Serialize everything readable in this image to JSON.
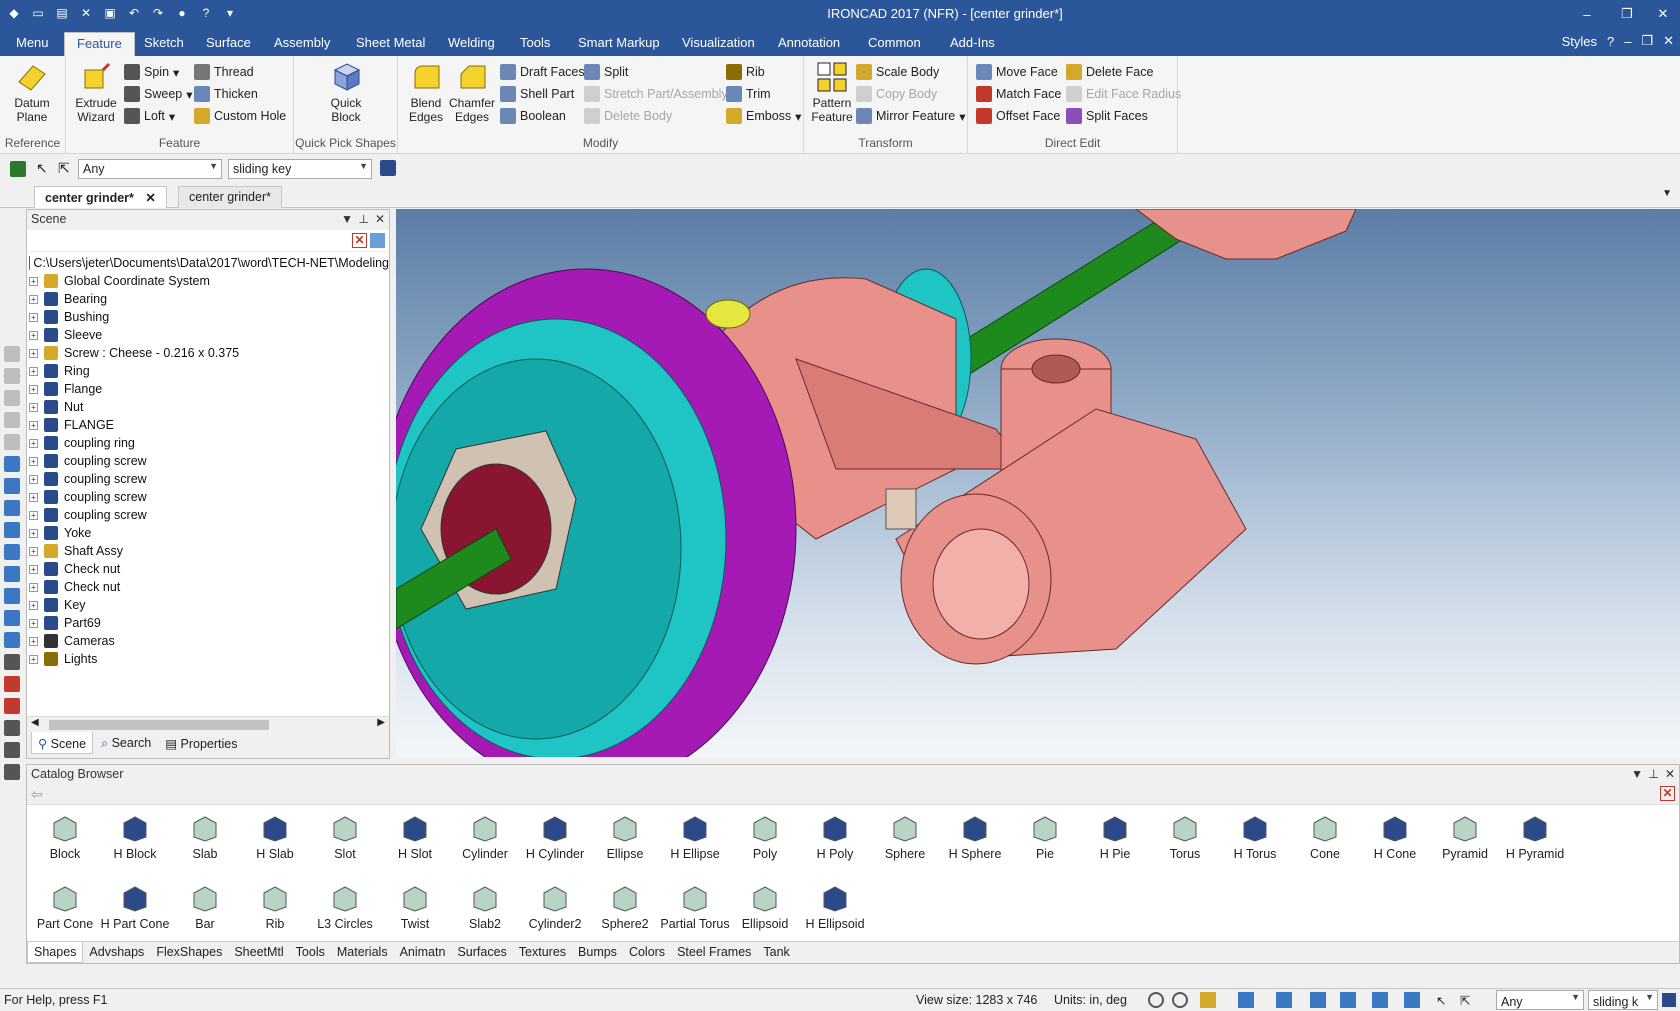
{
  "titlebar": {
    "title": "IRONCAD 2017 (NFR) - [center grinder*]",
    "minimize": "–",
    "restore": "❐",
    "close": "✕"
  },
  "menu_tabs": [
    "Menu",
    "Feature",
    "Sketch",
    "Surface",
    "Assembly",
    "Sheet Metal",
    "Welding",
    "Tools",
    "Smart Markup",
    "Visualization",
    "Annotation",
    "Common",
    "Add-Ins"
  ],
  "menu_right": {
    "styles": "Styles",
    "help": "?"
  },
  "ribbon": {
    "reference": {
      "label": "Reference",
      "datum_plane": "Datum Plane"
    },
    "feature": {
      "label": "Feature",
      "extrude_wizard": "Extrude Wizard",
      "spin": "Spin",
      "sweep": "Sweep",
      "loft": "Loft",
      "thread": "Thread",
      "thicken": "Thicken",
      "custom_hole": "Custom Hole"
    },
    "quick_pick": {
      "label": "Quick Pick Shapes",
      "quick_block": "Quick Block"
    },
    "modify": {
      "label": "Modify",
      "blend_edges": "Blend Edges",
      "chamfer_edges": "Chamfer Edges",
      "draft_faces": "Draft Faces",
      "shell_part": "Shell Part",
      "boolean": "Boolean",
      "split": "Split",
      "stretch": "Stretch Part/Assembly",
      "delete_body": "Delete Body",
      "rib": "Rib",
      "trim": "Trim",
      "emboss": "Emboss"
    },
    "transform": {
      "label": "Transform",
      "pattern_feature": "Pattern Feature",
      "scale_body": "Scale Body",
      "copy_body": "Copy Body",
      "mirror_feature": "Mirror Feature"
    },
    "direct_edit": {
      "label": "Direct Edit",
      "move_face": "Move Face",
      "match_face": "Match Face",
      "offset_face": "Offset Face",
      "delete_face": "Delete Face",
      "edit_face_radius": "Edit Face Radius",
      "split_faces": "Split Faces"
    }
  },
  "filter": {
    "type": "Any",
    "name": "sliding key"
  },
  "doc_tabs": [
    "center grinder*",
    "center grinder*"
  ],
  "scene": {
    "title": "Scene",
    "path": "C:\\Users\\jeter\\Documents\\Data\\2017\\word\\TECH-NET\\Modeling",
    "items": [
      "Global Coordinate System",
      "Bearing",
      "Bushing",
      "Sleeve",
      "Screw : Cheese - 0.216 x 0.375",
      "Ring",
      "Flange",
      "Nut",
      "FLANGE",
      "coupling ring",
      "coupling screw",
      "coupling screw",
      "coupling screw",
      "coupling screw",
      "Yoke",
      "Shaft Assy",
      "Check nut",
      "Check nut",
      "Key",
      "Part69",
      "Cameras",
      "Lights"
    ],
    "tabs": [
      "Scene",
      "Search",
      "Properties"
    ]
  },
  "catalog": {
    "title": "Catalog Browser",
    "row1": [
      "Block",
      "H Block",
      "Slab",
      "H Slab",
      "Slot",
      "H Slot",
      "Cylinder",
      "H Cylinder",
      "Ellipse",
      "H Ellipse",
      "Poly",
      "H Poly",
      "Sphere",
      "H Sphere",
      "Pie",
      "H Pie",
      "Torus",
      "H Torus",
      "Cone",
      "H Cone",
      "Pyramid",
      "H Pyramid"
    ],
    "row2": [
      "Part Cone",
      "H Part Cone",
      "Bar",
      "Rib",
      "L3 Circles",
      "Twist",
      "Slab2",
      "Cylinder2",
      "Sphere2",
      "Partial Torus",
      "Ellipsoid",
      "H Ellipsoid"
    ],
    "tabs": [
      "Shapes",
      "Advshaps",
      "FlexShapes",
      "SheetMtl",
      "Tools",
      "Materials",
      "Animatn",
      "Surfaces",
      "Textures",
      "Bumps",
      "Colors",
      "Steel Frames",
      "Tank"
    ]
  },
  "status": {
    "help": "For Help, press F1",
    "view_size": "View size: 1283 x 746",
    "units": "Units: in, deg",
    "filter_any": "Any",
    "filter_name": "sliding k"
  },
  "colors": {
    "accent": "#2b579a",
    "part_pink": "#e8908a",
    "flange_cyan": "#1fc4c4",
    "wheel_magenta": "#a51ab5",
    "shaft_green": "#1e8a1e"
  }
}
